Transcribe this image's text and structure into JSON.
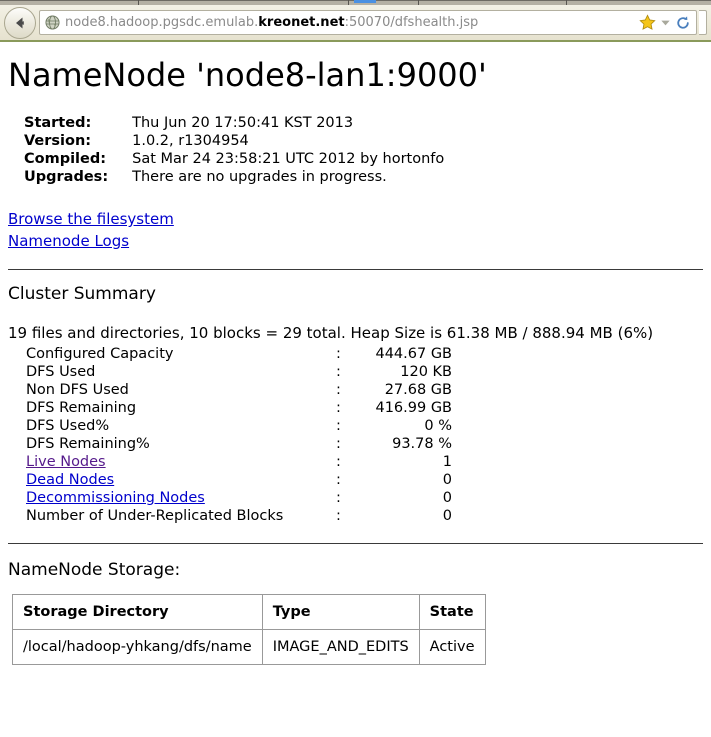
{
  "browser": {
    "back_icon": "back-arrow-icon",
    "favicon": "globe-icon",
    "url_prefix": "node8.hadoop.pgsdc.emulab.",
    "url_host_strong": "kreonet.net",
    "url_suffix": ":50070/dfshealth.jsp",
    "url_full": "node8.hadoop.pgsdc.emulab.kreonet.net:50070/dfshealth.jsp",
    "bookmark_icon": "star-icon",
    "dropdown_icon": "chevron-down-icon",
    "reload_icon": "reload-icon",
    "tab_active_color": "#4a90e2"
  },
  "page": {
    "title": "NameNode 'node8-lan1:9000'",
    "info": [
      {
        "label": "Started:",
        "value": "Thu Jun 20 17:50:41 KST 2013"
      },
      {
        "label": "Version:",
        "value": "1.0.2, r1304954"
      },
      {
        "label": "Compiled:",
        "value": "Sat Mar 24 23:58:21 UTC 2012 by hortonfo"
      },
      {
        "label": "Upgrades:",
        "value": "There are no upgrades in progress."
      }
    ],
    "links": [
      {
        "label": "Browse the filesystem",
        "state": "unvisited"
      },
      {
        "label": "Namenode Logs",
        "state": "unvisited"
      }
    ],
    "cluster_summary": {
      "heading": "Cluster Summary",
      "summary": "19 files and directories, 10 blocks = 29 total. Heap Size is 61.38 MB / 888.94 MB (6%)",
      "rows": [
        {
          "label": "Configured Capacity",
          "colon": ":",
          "value": "444.67 GB",
          "link": false
        },
        {
          "label": "DFS Used",
          "colon": ":",
          "value": "120 KB",
          "link": false
        },
        {
          "label": "Non DFS Used",
          "colon": ":",
          "value": "27.68 GB",
          "link": false
        },
        {
          "label": "DFS Remaining",
          "colon": ":",
          "value": "416.99 GB",
          "link": false
        },
        {
          "label": "DFS Used%",
          "colon": ":",
          "value": "0 %",
          "link": false
        },
        {
          "label": "DFS Remaining%",
          "colon": ":",
          "value": "93.78 %",
          "link": false
        },
        {
          "label": "Live Nodes",
          "colon": ":",
          "value": "1",
          "link": true,
          "state": "visited"
        },
        {
          "label": "Dead Nodes",
          "colon": ":",
          "value": "0",
          "link": true,
          "state": "unvisited"
        },
        {
          "label": "Decommissioning Nodes",
          "colon": ":",
          "value": "0",
          "link": true,
          "state": "unvisited"
        },
        {
          "label": "Number of Under-Replicated Blocks",
          "colon": ":",
          "value": "0",
          "link": false
        }
      ]
    },
    "storage": {
      "heading": "NameNode Storage:",
      "columns": [
        "Storage Directory",
        "Type",
        "State"
      ],
      "rows": [
        [
          "/local/hadoop-yhkang/dfs/name",
          "IMAGE_AND_EDITS",
          "Active"
        ]
      ]
    }
  }
}
